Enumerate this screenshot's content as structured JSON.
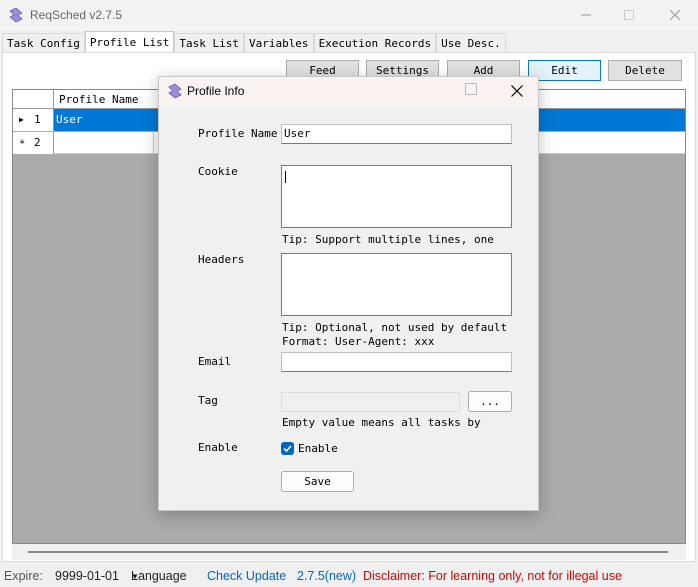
{
  "window": {
    "title": "ReqSched v2.7.5",
    "minimize_icon": "minimize-icon",
    "maximize_icon": "maximize-icon",
    "close_icon": "close-icon"
  },
  "tabs": [
    {
      "label": "Task Config"
    },
    {
      "label": "Profile List"
    },
    {
      "label": "Task List"
    },
    {
      "label": "Variables"
    },
    {
      "label": "Execution Records"
    },
    {
      "label": "Use Desc."
    }
  ],
  "active_tab": "Profile List",
  "toolbar": {
    "feed": "Feed",
    "settings": "Settings",
    "add": "Add",
    "edit": "Edit",
    "delete": "Delete"
  },
  "grid": {
    "columns": [
      "Profile Name"
    ],
    "rows": [
      {
        "num": "1",
        "name": "User",
        "selected": true
      },
      {
        "num": "2",
        "name": "",
        "selected": false
      }
    ]
  },
  "status": {
    "expire_label": "Expire:",
    "expire_date": "9999-01-01",
    "language": "Language",
    "check_update": "Check Update",
    "new_version": "2.7.5(new)",
    "disclaimer": "Disclaimer: For learning only, not for illegal use"
  },
  "dialog": {
    "title": "Profile Info",
    "profile_name_label": "Profile Name",
    "profile_name_value": "User",
    "cookie_label": "Cookie",
    "cookie_value": "",
    "cookie_tip": "Tip: Support multiple lines, one",
    "headers_label": "Headers",
    "headers_value": "",
    "headers_tip1": "Tip: Optional, not used by default",
    "headers_tip2": "Format: User-Agent: xxx",
    "email_label": "Email",
    "email_value": "",
    "tag_label": "Tag",
    "tag_value": "",
    "tag_button": "...",
    "tag_tip": "Empty value means all tasks by",
    "enable_label": "Enable",
    "enable_checkbox_label": "Enable",
    "enable_checked": true,
    "save_button": "Save"
  },
  "colors": {
    "accent": "#0078d7",
    "update_link": "#0067c0",
    "disclaimer": "#d40000"
  }
}
